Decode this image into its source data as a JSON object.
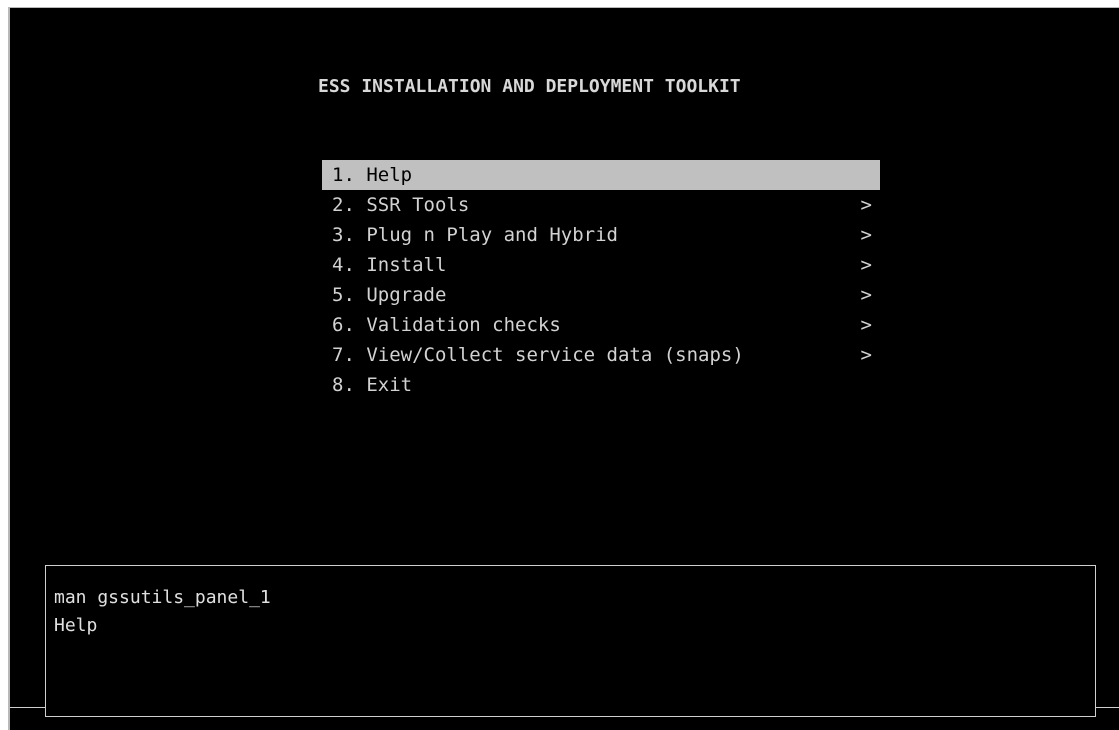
{
  "title": "ESS INSTALLATION AND DEPLOYMENT TOOLKIT",
  "menu": {
    "items": [
      {
        "label": "1. Help",
        "arrow": ""
      },
      {
        "label": "2. SSR Tools",
        "arrow": ">"
      },
      {
        "label": "3. Plug n Play and Hybrid",
        "arrow": ">"
      },
      {
        "label": "4. Install",
        "arrow": ">"
      },
      {
        "label": "5. Upgrade",
        "arrow": ">"
      },
      {
        "label": "6. Validation checks",
        "arrow": ">"
      },
      {
        "label": "7. View/Collect service data (snaps)",
        "arrow": ">"
      },
      {
        "label": "8. Exit",
        "arrow": ""
      }
    ],
    "selected_index": 0
  },
  "help_panel": {
    "command": "man gssutils_panel_1",
    "description": "Help"
  },
  "colors": {
    "background": "#000000",
    "text": "#d2d2d2",
    "highlight": "#c0c0c0"
  }
}
